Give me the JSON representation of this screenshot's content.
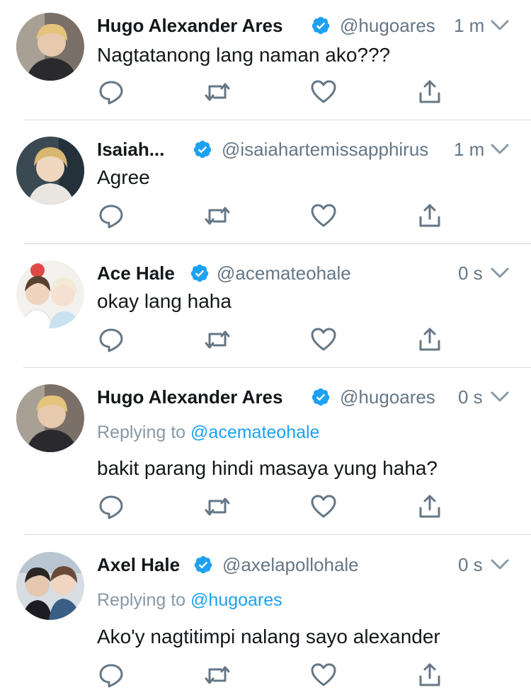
{
  "colors": {
    "verified": "#1da1f2",
    "mention": "#1da1f2",
    "text": "#14171a",
    "secondary": "#657786",
    "reply_gray": "#8899a6",
    "icon": "#657786",
    "divider": "#d6d9dc"
  },
  "tweets": [
    {
      "name": "Hugo Alexander Ares",
      "verified": true,
      "handle": "@hugoares",
      "time": "1 m",
      "reply_prefix": "",
      "reply_mention": "",
      "text": "Nagtatanong lang naman ako???",
      "avatar": "avatar-hugo"
    },
    {
      "name": "Isaiah...",
      "verified": true,
      "handle": "@isaiahartemissapphirus",
      "time": "1 m",
      "reply_prefix": "",
      "reply_mention": "",
      "text": "Agree",
      "avatar": "avatar-isaiah"
    },
    {
      "name": "Ace Hale",
      "verified": true,
      "handle": "@acemateohale",
      "time": "0 s",
      "reply_prefix": "",
      "reply_mention": "",
      "text": "okay lang haha",
      "avatar": "avatar-ace"
    },
    {
      "name": "Hugo Alexander Ares",
      "verified": true,
      "handle": "@hugoares",
      "time": "0 s",
      "reply_prefix": "Replying to ",
      "reply_mention": "@acemateohale",
      "text": "bakit parang hindi masaya yung haha?",
      "avatar": "avatar-hugo"
    },
    {
      "name": "Axel Hale",
      "verified": true,
      "handle": "@axelapollohale",
      "time": "0 s",
      "reply_prefix": "Replying to ",
      "reply_mention": "@hugoares",
      "text": "Ako'y nagtitimpi nalang sayo alexander",
      "avatar": "avatar-axel"
    }
  ],
  "icons": {
    "reply": "reply-icon",
    "retweet": "retweet-icon",
    "like": "heart-icon",
    "share": "share-icon",
    "caret": "chevron-down-icon",
    "verified": "verified-badge-icon"
  }
}
